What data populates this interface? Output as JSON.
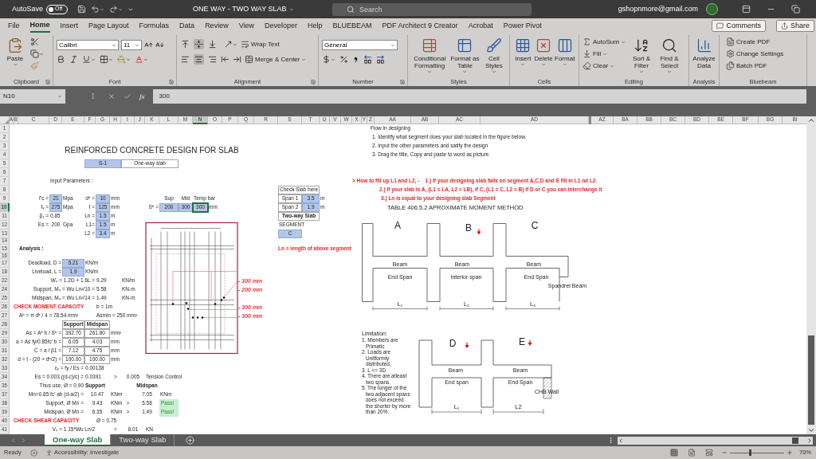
{
  "title_bar": {
    "autosave_label": "AutoSave",
    "autosave": {
      "on": false,
      "label": "Off"
    },
    "document_title": "ONE WAY - TWO WAY SLAB",
    "search_placeholder": "Search",
    "account": "gshopnmore@gmail.com"
  },
  "menu_tabs": [
    {
      "label": "File",
      "selected": false
    },
    {
      "label": "Home",
      "selected": true
    },
    {
      "label": "Insert",
      "selected": false
    },
    {
      "label": "Page Layout",
      "selected": false
    },
    {
      "label": "Formulas",
      "selected": false
    },
    {
      "label": "Data",
      "selected": false
    },
    {
      "label": "Review",
      "selected": false
    },
    {
      "label": "View",
      "selected": false
    },
    {
      "label": "Developer",
      "selected": false
    },
    {
      "label": "Help",
      "selected": false
    },
    {
      "label": "BLUEBEAM",
      "selected": false
    },
    {
      "label": "PDF Architect 9 Creator",
      "selected": false
    },
    {
      "label": "Acrobat",
      "selected": false
    },
    {
      "label": "Power Pivot",
      "selected": false
    }
  ],
  "comments_button": "Comments",
  "share_button": "Share",
  "ribbon": {
    "paste": "Paste",
    "font_name": "Calibri",
    "font_size": "11",
    "wrap_text": "Wrap Text",
    "merge_center": "Merge & Center",
    "alignment_buttons": [
      {
        "kind": "top",
        "selected": false
      },
      {
        "kind": "middle",
        "selected": true
      },
      {
        "kind": "bottom",
        "selected": false
      },
      {
        "kind": "left",
        "selected": false
      },
      {
        "kind": "center",
        "selected": true
      },
      {
        "kind": "right",
        "selected": false
      }
    ],
    "number_format": "General",
    "styles_buttons": [
      "Conditional Formatting",
      "Format as Table",
      "Cell Styles"
    ],
    "cells_buttons": [
      "Insert",
      "Delete",
      "Format"
    ],
    "autosum": "AutoSum",
    "fill": "Fill",
    "clear": "Clear",
    "sort_filter": "Sort & Filter",
    "find_select": "Find & Select",
    "analyze": "Analyze Data",
    "bluebeam": [
      "Create PDF",
      "Change Settings",
      "Batch PDF"
    ],
    "group_labels": [
      "Clipboard",
      "Font",
      "Alignment",
      "Number",
      "Styles",
      "Cells",
      "Editing",
      "Analysis",
      "Bluebeam"
    ]
  },
  "formula_bar": {
    "name_box": "N10",
    "fx": "fx",
    "value": "300"
  },
  "columns": [
    {
      "label": "A",
      "selected": false
    },
    {
      "label": "B",
      "selected": false
    },
    {
      "label": "C",
      "selected": false
    },
    {
      "label": "D",
      "selected": false
    },
    {
      "label": "E",
      "selected": false
    },
    {
      "label": "F",
      "selected": false
    },
    {
      "label": "G",
      "selected": false
    },
    {
      "label": "H",
      "selected": false
    },
    {
      "label": "I",
      "selected": false
    },
    {
      "label": "J",
      "selected": false
    },
    {
      "label": "K",
      "selected": false
    },
    {
      "label": "L",
      "selected": false
    },
    {
      "label": "M",
      "selected": false
    },
    {
      "label": "N",
      "selected": true
    },
    {
      "label": "O",
      "selected": false
    },
    {
      "label": "P",
      "selected": false
    },
    {
      "label": "Q",
      "selected": false
    },
    {
      "label": "R",
      "selected": false
    },
    {
      "label": "S",
      "selected": false
    },
    {
      "label": "T",
      "selected": false
    },
    {
      "label": "U",
      "selected": false
    },
    {
      "label": "V",
      "selected": false
    },
    {
      "label": "W",
      "selected": false
    },
    {
      "label": "X",
      "selected": false
    },
    {
      "label": "Y",
      "selected": false
    },
    {
      "label": "Z",
      "selected": false
    },
    {
      "label": "AA",
      "selected": false
    },
    {
      "label": "AB",
      "selected": false
    },
    {
      "label": "AC",
      "selected": false
    },
    {
      "label": "AD",
      "selected": false
    },
    {
      "label": "AZ",
      "selected": false
    },
    {
      "label": "BA",
      "selected": false
    },
    {
      "label": "BB",
      "selected": false
    },
    {
      "label": "BC",
      "selected": false
    },
    {
      "label": "BD",
      "selected": false
    },
    {
      "label": "BE",
      "selected": false
    },
    {
      "label": "BF",
      "selected": false
    },
    {
      "label": "BG",
      "selected": false
    },
    {
      "label": "BI",
      "selected": false
    }
  ],
  "rows": [
    {
      "label": "1",
      "selected": false
    },
    {
      "label": "2",
      "selected": false
    },
    {
      "label": "3",
      "selected": false
    },
    {
      "label": "4",
      "selected": false
    },
    {
      "label": "5",
      "selected": false
    },
    {
      "label": "6",
      "selected": false
    },
    {
      "label": "7",
      "selected": false
    },
    {
      "label": "8",
      "selected": false
    },
    {
      "label": "9",
      "selected": false
    },
    {
      "label": "10",
      "selected": true
    },
    {
      "label": "11",
      "selected": false
    },
    {
      "label": "12",
      "selected": false
    },
    {
      "label": "13",
      "selected": false
    },
    {
      "label": "14",
      "selected": false
    },
    {
      "label": "15",
      "selected": false
    },
    {
      "label": "16",
      "selected": false
    },
    {
      "label": "17",
      "selected": false
    },
    {
      "label": "18",
      "selected": false
    },
    {
      "label": "22",
      "selected": false
    },
    {
      "label": "24",
      "selected": false
    },
    {
      "label": "25",
      "selected": false
    },
    {
      "label": "26",
      "selected": false
    },
    {
      "label": "27",
      "selected": false
    },
    {
      "label": "28",
      "selected": false
    },
    {
      "label": "29",
      "selected": false
    },
    {
      "label": "30",
      "selected": false
    },
    {
      "label": "31",
      "selected": false
    },
    {
      "label": "32",
      "selected": false
    },
    {
      "label": "33",
      "selected": false
    },
    {
      "label": "34",
      "selected": false
    },
    {
      "label": "35",
      "selected": false
    },
    {
      "label": "37",
      "selected": false
    },
    {
      "label": "38",
      "selected": false
    },
    {
      "label": "39",
      "selected": false
    },
    {
      "label": "40",
      "selected": false
    },
    {
      "label": "41",
      "selected": false
    }
  ],
  "cells": [
    {
      "text": "REINFORCED CONCRETE DESIGN FOR SLAB",
      "kind": "title",
      "selected": false
    },
    {
      "text": "S-1",
      "kind": "input",
      "selected": false
    },
    {
      "text": "One-way slab",
      "kind": "box",
      "selected": false
    },
    {
      "text": "Input Parameters :",
      "kind": "label",
      "selected": false
    },
    {
      "text": "f'c =",
      "kind": "label_right",
      "selected": false
    },
    {
      "text": "21",
      "kind": "input",
      "selected": false
    },
    {
      "text": "Mpa",
      "kind": "label",
      "selected": false
    },
    {
      "text": "dᵇ =",
      "kind": "label_right",
      "selected": false
    },
    {
      "text": "10",
      "kind": "input",
      "selected": false
    },
    {
      "text": "mm",
      "kind": "label",
      "selected": false
    },
    {
      "text": "Sup",
      "kind": "label_center",
      "selected": false
    },
    {
      "text": "Mid",
      "kind": "label_center",
      "selected": false
    },
    {
      "text": "Temp bar",
      "kind": "label",
      "selected": false
    },
    {
      "text": "Check Slab here",
      "kind": "box",
      "selected": false
    },
    {
      "text": "Span 1",
      "kind": "box",
      "selected": false
    },
    {
      "text": "3.5",
      "kind": "input",
      "selected": false
    },
    {
      "text": "m",
      "kind": "label",
      "selected": false
    },
    {
      "text": "fᵧ =",
      "kind": "label_right",
      "selected": false
    },
    {
      "text": "275",
      "kind": "input",
      "selected": false
    },
    {
      "text": "Mpa",
      "kind": "label",
      "selected": false
    },
    {
      "text": "t =",
      "kind": "label_right",
      "selected": false
    },
    {
      "text": "125",
      "kind": "input",
      "selected": false
    },
    {
      "text": "mm",
      "kind": "label",
      "selected": false
    },
    {
      "text": "Sᵇ =",
      "kind": "label_right",
      "selected": false
    },
    {
      "text": "200",
      "kind": "input",
      "selected": false
    },
    {
      "text": "300",
      "kind": "input",
      "selected": false
    },
    {
      "text": "300",
      "kind": "input",
      "selected": true
    },
    {
      "text": "mm",
      "kind": "label",
      "selected": false
    },
    {
      "text": "Span 2",
      "kind": "box",
      "selected": false
    },
    {
      "text": "1.9",
      "kind": "input",
      "selected": false
    },
    {
      "text": "m",
      "kind": "label",
      "selected": false
    },
    {
      "text": "β₁ =",
      "kind": "label_right",
      "selected": false
    },
    {
      "text": "0.85",
      "kind": "label",
      "selected": false
    },
    {
      "text": "Ln =",
      "kind": "label_right",
      "selected": false
    },
    {
      "text": "1.5",
      "kind": "input",
      "selected": false
    },
    {
      "text": "m",
      "kind": "label",
      "selected": false
    },
    {
      "text": "Two-way Slab",
      "kind": "box_bold",
      "selected": false
    },
    {
      "text": "Es =",
      "kind": "label_right",
      "selected": false
    },
    {
      "text": "200",
      "kind": "label_center",
      "selected": false
    },
    {
      "text": "Gpa",
      "kind": "label",
      "selected": false
    },
    {
      "text": "L1=",
      "kind": "label_right",
      "selected": false
    },
    {
      "text": "1.5",
      "kind": "input",
      "selected": false
    },
    {
      "text": "m",
      "kind": "label",
      "selected": false
    },
    {
      "text": "SEGMENT",
      "kind": "label",
      "selected": false
    },
    {
      "text": "L2 =",
      "kind": "label_right",
      "selected": false
    },
    {
      "text": "3.4",
      "kind": "input",
      "selected": false
    },
    {
      "text": "m",
      "kind": "label",
      "selected": false
    },
    {
      "text": "C",
      "kind": "input",
      "selected": false
    },
    {
      "text": "Analysis :",
      "kind": "bold",
      "selected": false
    },
    {
      "text": "Ln = length of above segment",
      "kind": "note",
      "selected": false
    },
    {
      "text": "Deadload, D =",
      "kind": "label_right",
      "selected": false
    },
    {
      "text": "5.21",
      "kind": "input",
      "selected": false
    },
    {
      "text": "KN/m",
      "kind": "label",
      "selected": false
    },
    {
      "text": "Liveload, L =",
      "kind": "label_right",
      "selected": false
    },
    {
      "text": "1.9",
      "kind": "input",
      "selected": false
    },
    {
      "text": "KN/m",
      "kind": "label",
      "selected": false
    },
    {
      "text": "Wᵤ = 1.2D + 1.6L =",
      "kind": "label_right",
      "selected": false
    },
    {
      "text": "9.29",
      "kind": "label",
      "selected": false
    },
    {
      "text": "KN/m",
      "kind": "label",
      "selected": false
    },
    {
      "text": "Support, Mᵤ = Wu Ln²/10 =",
      "kind": "label_right",
      "selected": false
    },
    {
      "text": "5.58",
      "kind": "label",
      "selected": false
    },
    {
      "text": "KN-m",
      "kind": "label",
      "selected": false
    },
    {
      "text": "Midspan, Mᵤ = Wu Ln²/14 =",
      "kind": "label_right",
      "selected": false
    },
    {
      "text": "1.49",
      "kind": "label",
      "selected": false
    },
    {
      "text": "KN-m",
      "kind": "label",
      "selected": false
    },
    {
      "text": "CHECK MOMENT CAPACITY",
      "kind": "heading",
      "selected": false
    },
    {
      "text": "b = 1m",
      "kind": "label",
      "selected": false
    },
    {
      "text": "Aᵇ = π dᵇ / 4 = 78.54 mm²",
      "kind": "label",
      "selected": false
    },
    {
      "text": "Asmin = 250 mm²",
      "kind": "label",
      "selected": false
    },
    {
      "text": "Support",
      "kind": "table_head",
      "selected": false
    },
    {
      "text": "Midspan",
      "kind": "table_head",
      "selected": false
    },
    {
      "text": "As = Aᵇ b / Sᵇ =",
      "kind": "label_right",
      "selected": false
    },
    {
      "text": "392.70",
      "kind": "table",
      "selected": false
    },
    {
      "text": "261.80",
      "kind": "table",
      "selected": false
    },
    {
      "text": "mm²",
      "kind": "label",
      "selected": false
    },
    {
      "text": "a = As fy/0.85fc' b =",
      "kind": "label_right",
      "selected": false
    },
    {
      "text": "6.05",
      "kind": "table",
      "selected": false
    },
    {
      "text": "4.03",
      "kind": "table",
      "selected": false
    },
    {
      "text": "mm",
      "kind": "label",
      "selected": false
    },
    {
      "text": "C = a / β1 =",
      "kind": "label_right",
      "selected": false
    },
    {
      "text": "7.12",
      "kind": "table",
      "selected": false
    },
    {
      "text": "4.75",
      "kind": "table",
      "selected": false
    },
    {
      "text": "mm",
      "kind": "label",
      "selected": false
    },
    {
      "text": "d = t - (20 + dᵇ/2) =",
      "kind": "label_right",
      "selected": false
    },
    {
      "text": "100.00",
      "kind": "table",
      "selected": false
    },
    {
      "text": "100.00",
      "kind": "table",
      "selected": false
    },
    {
      "text": "mm",
      "kind": "label",
      "selected": false
    },
    {
      "text": "εᵧ = fy / Es =",
      "kind": "label_right",
      "selected": false
    },
    {
      "text": "0.00138",
      "kind": "label",
      "selected": false
    },
    {
      "text": "Es = 0.003 ((d-c)/c) =",
      "kind": "label_right",
      "selected": false
    },
    {
      "text": "0.0391",
      "kind": "label",
      "selected": false
    },
    {
      "text": ">",
      "kind": "label_center",
      "selected": false
    },
    {
      "text": "0.005",
      "kind": "label_center",
      "selected": false
    },
    {
      "text": "Tension Control",
      "kind": "label",
      "selected": false
    },
    {
      "text": "Thus use, Ø = 0.90",
      "kind": "label_right",
      "selected": false
    },
    {
      "text": "Support",
      "kind": "bold",
      "selected": false
    },
    {
      "text": "Midspan",
      "kind": "bold_center",
      "selected": false
    },
    {
      "text": "Mn=0.85 fc' ab (d-a/2) =",
      "kind": "label_right",
      "selected": false
    },
    {
      "text": "10.47",
      "kind": "label_center",
      "selected": false
    },
    {
      "text": "KNm",
      "kind": "label",
      "selected": false
    },
    {
      "text": "7.05",
      "kind": "label_center",
      "selected": false
    },
    {
      "text": "KNm",
      "kind": "label",
      "selected": false
    },
    {
      "text": "Support, Ø Mn =",
      "kind": "label_right",
      "selected": false
    },
    {
      "text": "9.43",
      "kind": "label_center",
      "selected": false
    },
    {
      "text": "KNm",
      "kind": "label",
      "selected": false
    },
    {
      "text": ">",
      "kind": "label_center",
      "selected": false
    },
    {
      "text": "5.58",
      "kind": "label_center",
      "selected": false
    },
    {
      "text": "Pass!",
      "kind": "pass",
      "selected": false
    },
    {
      "text": "Midspan, Ø Mn =",
      "kind": "label_right",
      "selected": false
    },
    {
      "text": "6.35",
      "kind": "label_center",
      "selected": false
    },
    {
      "text": "KNm",
      "kind": "label",
      "selected": false
    },
    {
      "text": ">",
      "kind": "label_center",
      "selected": false
    },
    {
      "text": "1.49",
      "kind": "label_center",
      "selected": false
    },
    {
      "text": "Pass!",
      "kind": "pass",
      "selected": false
    },
    {
      "text": "CHECK SHEAR CAPACITY",
      "kind": "heading",
      "selected": false
    },
    {
      "text": "Ø = 0.75",
      "kind": "label",
      "selected": false
    },
    {
      "text": "Vᵤ = 1.15*Wu Ln/2",
      "kind": "label_right",
      "selected": false
    },
    {
      "text": "=",
      "kind": "label_center",
      "selected": false
    },
    {
      "text": "8.01",
      "kind": "label_center",
      "selected": false
    },
    {
      "text": "KN",
      "kind": "label",
      "selected": false
    },
    {
      "text": "- 300 mm",
      "kind": "callout",
      "selected": false
    },
    {
      "text": "- 200 mm",
      "kind": "callout",
      "selected": false
    },
    {
      "text": "- 300 mm",
      "kind": "callout",
      "selected": false
    },
    {
      "text": "- 300 mm",
      "kind": "callout",
      "selected": false
    }
  ],
  "design_flow": {
    "title": "Flow in designing",
    "steps": [
      "1. Identify what segment does your slab located in the figure below.",
      "2. Input the other parameters and satify the design",
      "3. Drag the title, Copy and paste to word as picture."
    ]
  },
  "fill_instructions": [
    "> How to fill up L1 and L2, -    1.) If your designing slab falls on segment A,C,D and E fill in L1 nd L2.",
    "2.) If your slab is A, (L1 = LA, L2 = LB), if C, (L1 = C, L2 = B) if D or C you can interchange it",
    "3.) Ln is equal to your designing slab Segment"
  ],
  "moment_table_title": "TABLE 406.5.2 APROXIMATE MOMENT METHOD",
  "segment_diagram_top": {
    "labels": [
      "A",
      "B",
      "C"
    ],
    "beams": [
      "Beam",
      "Beam",
      "Beam"
    ],
    "spans": [
      "End Span",
      "Interior span",
      "End Span"
    ],
    "spandrel": "Spandrel Beam",
    "lengths": [
      "L₁",
      "L₂",
      "L₃"
    ]
  },
  "limitations": {
    "title": "Limitation:",
    "items": [
      "1. Members are Primatic",
      "2. Loads are Unitformly distributed.",
      "3. L <= 3D",
      "4. There are atleast two spans.",
      "5. The longer of the two adjacent spans does not exceed the shorter by more than 20%."
    ]
  },
  "segment_diagram_bottom": {
    "labels": [
      "D",
      "E"
    ],
    "beams": [
      "Beam",
      "Beam"
    ],
    "spans": [
      "End span",
      "End Span"
    ],
    "wall": "CHB Wall",
    "lengths": [
      "L₁",
      "L2"
    ]
  },
  "sheet_tabs": [
    {
      "label": "One-way Slab",
      "selected": true
    },
    {
      "label": "Two-way Slab",
      "selected": false
    }
  ],
  "status_bar": {
    "ready": "Ready",
    "accessibility": "Accessibility: Investigate",
    "zoom_slider": {
      "level": 0.36
    },
    "zoom": "70%"
  }
}
